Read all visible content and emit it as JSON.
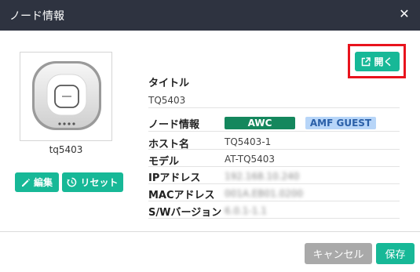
{
  "dialog": {
    "title": "ノード情報",
    "close_icon": "close-icon"
  },
  "device": {
    "icon": "access-point-icon",
    "name": "tq5403"
  },
  "left_buttons": {
    "edit_label": "編集",
    "reset_label": "リセット"
  },
  "open_button": {
    "label": "開く",
    "icon": "external-link-icon"
  },
  "info": {
    "title_label": "タイトル",
    "title_value": "TQ5403",
    "node_info_label": "ノード情報",
    "badges": [
      "AWC",
      "AMF GUEST"
    ],
    "rows": [
      {
        "label": "ホスト名",
        "value": "TQ5403-1"
      },
      {
        "label": "モデル",
        "value": "AT-TQ5403"
      },
      {
        "label": "IPアドレス",
        "value": "192.168.10.240"
      },
      {
        "label": "MACアドレス",
        "value": "001A.EB01.0200"
      },
      {
        "label": "S/Wバージョン",
        "value": "6.0.1-1.1"
      }
    ]
  },
  "footer": {
    "cancel_label": "キャンセル",
    "save_label": "保存"
  },
  "colors": {
    "titlebar": "#2e3340",
    "accent": "#17b897",
    "awc_badge": "#14875d",
    "amf_badge": "#b7d5f8",
    "highlight": "#e8131d"
  }
}
